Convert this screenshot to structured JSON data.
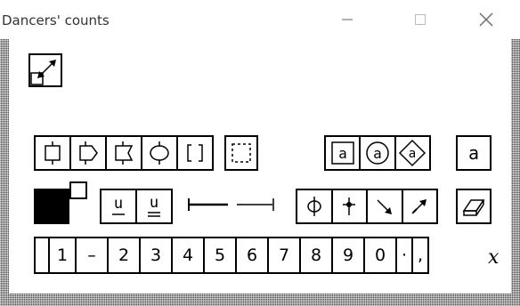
{
  "window": {
    "title": "Dancers' counts",
    "controls": [
      "minimize-icon",
      "maximize-icon",
      "close-icon"
    ]
  },
  "toolbar": {
    "resize_icon": "diagonal-resize-icon",
    "frame_shapes": [
      "box-frame-icon",
      "arrow-frame-icon",
      "notched-frame-icon",
      "oval-frame-icon",
      "bracket-frame-icon"
    ],
    "dashed_frame": "dashed-frame-icon",
    "letter_a_variants": [
      "a",
      "a",
      "a"
    ],
    "plain_a": "a",
    "color_swatch": {
      "foreground": "#000000",
      "background": "#ffffff"
    },
    "underline_letters": [
      "u",
      "u"
    ],
    "line_styles": [
      "line-start-cap-icon",
      "line-end-cap-icon"
    ],
    "direction_icons": [
      "phi-icon",
      "cross-dot-icon",
      "arrow-down-right-icon",
      "arrow-up-right-icon"
    ],
    "eraser": "eraser-icon"
  },
  "counts": {
    "items": [
      "1",
      "–",
      "2",
      "3",
      "4",
      "5",
      "6",
      "7",
      "8",
      "9",
      "0",
      "·",
      ","
    ],
    "variable": "x"
  }
}
